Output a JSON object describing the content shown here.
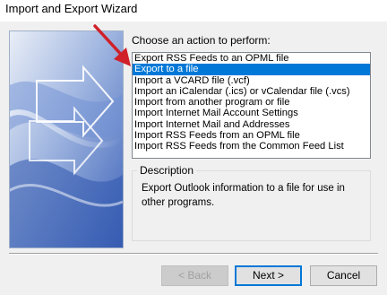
{
  "window": {
    "title": "Import and Export Wizard"
  },
  "prompt": "Choose an action to perform:",
  "actions": [
    {
      "label": "Export RSS Feeds to an OPML file",
      "selected": false
    },
    {
      "label": "Export to a file",
      "selected": true
    },
    {
      "label": "Import a VCARD file (.vcf)",
      "selected": false
    },
    {
      "label": "Import an iCalendar (.ics) or vCalendar file (.vcs)",
      "selected": false
    },
    {
      "label": "Import from another program or file",
      "selected": false
    },
    {
      "label": "Import Internet Mail Account Settings",
      "selected": false
    },
    {
      "label": "Import Internet Mail and Addresses",
      "selected": false
    },
    {
      "label": "Import RSS Feeds from an OPML file",
      "selected": false
    },
    {
      "label": "Import RSS Feeds from the Common Feed List",
      "selected": false
    }
  ],
  "description": {
    "heading": "Description",
    "text": "Export Outlook information to a file for use in other programs."
  },
  "buttons": {
    "back": "< Back",
    "next": "Next >",
    "cancel": "Cancel"
  },
  "colors": {
    "selection": "#0078d7",
    "annotation_arrow": "#d0202a",
    "dialog_bg": "#f0f0f0"
  },
  "icons": {
    "side_image": "wizard-banner-arrows-icon",
    "annotation": "red-pointer-arrow-icon"
  }
}
